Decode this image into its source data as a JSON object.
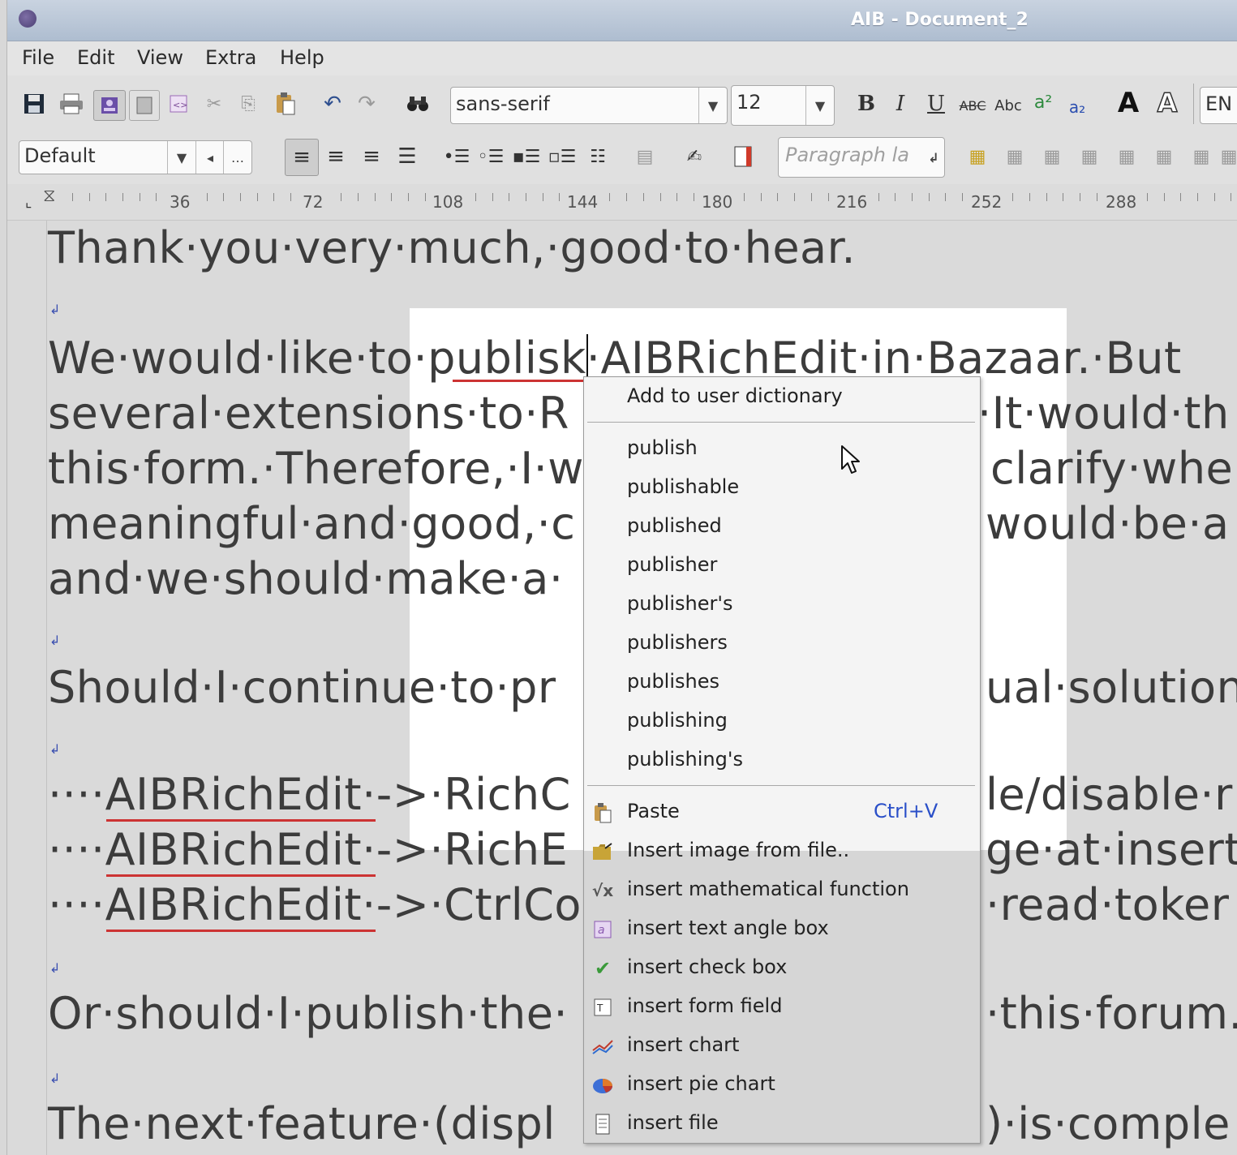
{
  "window": {
    "title": "AIB - Document_2"
  },
  "menu": [
    "File",
    "Edit",
    "View",
    "Extra",
    "Help"
  ],
  "toolbar1": {
    "font_family": "sans-serif",
    "font_size": "12",
    "language": "EN",
    "text_buttons": [
      "B",
      "I",
      "U",
      "ABC",
      "Abc",
      "a²",
      "a₂",
      "A",
      "A"
    ]
  },
  "toolbar2": {
    "style": "Default",
    "paragraph_placeholder": "Paragraph la"
  },
  "ruler": {
    "labels": [
      "36",
      "72",
      "108",
      "144",
      "180",
      "216",
      "252",
      "288"
    ]
  },
  "document": {
    "lines": [
      "Thank·you·very·much,·good·to·hear.",
      "We·would·like·to·publisk·AIBRichEdit·in·Bazaar.·But",
      "several·extensions·to·R",
      "this·form.·Therefore,·I·w",
      "meaningful·and·good,·c",
      "and·we·should·make·a·",
      "Should·I·continue·to·pr",
      "····AIBRichEdit·->·RichC",
      "····AIBRichEdit·->·RichE",
      "····AIBRichEdit·->·CtrlCo",
      "Or·should·I·publish·the·",
      "The·next·feature·(displ"
    ],
    "right_fragments": [
      "·It·would·th",
      "clarify·whe",
      "would·be·a",
      "ual·solution",
      "le/disable·r",
      "ge·at·insert",
      "·read·toker",
      "·this·forum.",
      ")·is·comple"
    ]
  },
  "context_menu": {
    "add_dictionary": "Add to user dictionary",
    "suggestions": [
      "publish",
      "publishable",
      "published",
      "publisher",
      "publisher's",
      "publishers",
      "publishes",
      "publishing",
      "publishing's"
    ],
    "paste": {
      "label": "Paste",
      "shortcut": "Ctrl+V"
    },
    "insert_items": [
      {
        "label": "Insert image from file..",
        "icon": "folder-icon"
      },
      {
        "label": "insert mathematical function",
        "icon": "sqrt-icon"
      },
      {
        "label": "insert text angle box",
        "icon": "text-box-icon"
      },
      {
        "label": "insert check box",
        "icon": "checkmark-icon"
      },
      {
        "label": "insert form field",
        "icon": "form-field-icon"
      },
      {
        "label": "insert chart",
        "icon": "line-chart-icon"
      },
      {
        "label": "insert pie chart",
        "icon": "pie-chart-icon"
      },
      {
        "label": "insert file",
        "icon": "file-icon"
      }
    ]
  }
}
